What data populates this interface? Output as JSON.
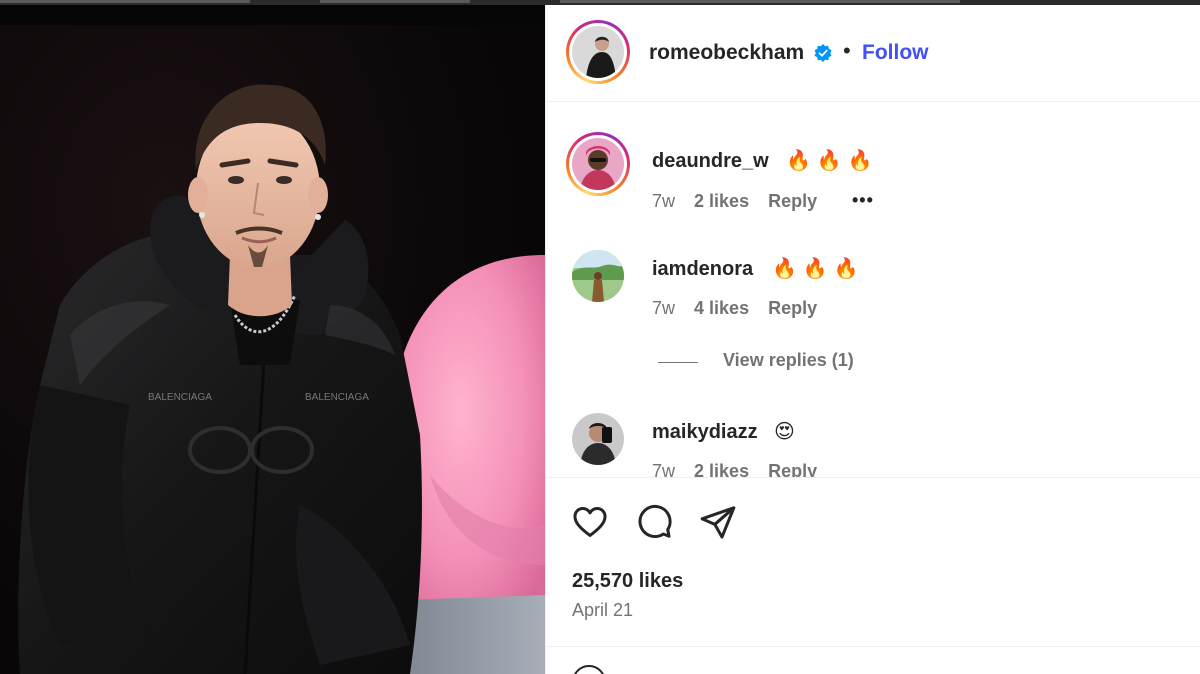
{
  "post": {
    "author": "romeobeckham",
    "follow_label": "Follow",
    "separator": "•",
    "likes": "25,570 likes",
    "date": "April 21"
  },
  "comments": [
    {
      "username": "deaundre_w",
      "text": "🔥🔥🔥",
      "age": "7w",
      "likes": "2 likes",
      "reply_label": "Reply",
      "more": "•••"
    },
    {
      "username": "iamdenora",
      "text": "🔥🔥🔥",
      "age": "7w",
      "likes": "4 likes",
      "reply_label": "Reply",
      "view_replies": "View replies (1)"
    },
    {
      "username": "maikydiazz",
      "text": "😍",
      "age": "7w",
      "likes": "2 likes",
      "reply_label": "Reply"
    }
  ],
  "icons": {
    "verified": "verified-badge-icon",
    "like": "heart-icon",
    "comment": "comment-icon",
    "share": "share-icon",
    "emoji": "emoji-icon"
  },
  "colors": {
    "follow": "#4150f7",
    "verified": "#0095f6",
    "meta_text": "#737373",
    "primary_text": "#262626"
  }
}
